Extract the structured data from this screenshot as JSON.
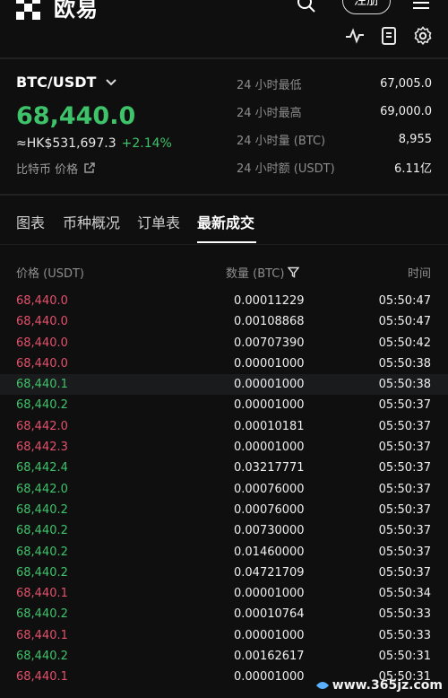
{
  "header": {
    "logo_text": "欧易",
    "register_label": "注册"
  },
  "ticker": {
    "pair": "BTC/USDT",
    "price": "68,440.0",
    "fiat_price": "≈HK$531,697.3",
    "change": "+2.14%",
    "link_label": "比特币 价格",
    "stats": [
      {
        "label": "24 小时最低",
        "value": "67,005.0"
      },
      {
        "label": "24 小时最高",
        "value": "69,000.0"
      },
      {
        "label": "24 小时量 (BTC)",
        "value": "8,955"
      },
      {
        "label": "24 小时额 (USDT)",
        "value": "6.11亿"
      }
    ]
  },
  "tabs": [
    {
      "label": "图表"
    },
    {
      "label": "币种概况"
    },
    {
      "label": "订单表"
    },
    {
      "label": "最新成交"
    }
  ],
  "columns": {
    "price": "价格 (USDT)",
    "qty": "数量 (BTC)",
    "time": "时间"
  },
  "trades": [
    {
      "price": "68,440.0",
      "qty": "0.00011229",
      "time": "05:50:47",
      "side": "sell"
    },
    {
      "price": "68,440.0",
      "qty": "0.00108868",
      "time": "05:50:47",
      "side": "sell"
    },
    {
      "price": "68,440.0",
      "qty": "0.00707390",
      "time": "05:50:42",
      "side": "sell"
    },
    {
      "price": "68,440.0",
      "qty": "0.00001000",
      "time": "05:50:38",
      "side": "sell"
    },
    {
      "price": "68,440.1",
      "qty": "0.00001000",
      "time": "05:50:38",
      "side": "buy"
    },
    {
      "price": "68,440.2",
      "qty": "0.00001000",
      "time": "05:50:37",
      "side": "buy"
    },
    {
      "price": "68,442.0",
      "qty": "0.00010181",
      "time": "05:50:37",
      "side": "sell"
    },
    {
      "price": "68,442.3",
      "qty": "0.00001000",
      "time": "05:50:37",
      "side": "sell"
    },
    {
      "price": "68,442.4",
      "qty": "0.03217771",
      "time": "05:50:37",
      "side": "buy"
    },
    {
      "price": "68,442.0",
      "qty": "0.00076000",
      "time": "05:50:37",
      "side": "buy"
    },
    {
      "price": "68,440.2",
      "qty": "0.00076000",
      "time": "05:50:37",
      "side": "buy"
    },
    {
      "price": "68,440.2",
      "qty": "0.00730000",
      "time": "05:50:37",
      "side": "buy"
    },
    {
      "price": "68,440.2",
      "qty": "0.01460000",
      "time": "05:50:37",
      "side": "buy"
    },
    {
      "price": "68,440.2",
      "qty": "0.04721709",
      "time": "05:50:37",
      "side": "buy"
    },
    {
      "price": "68,440.1",
      "qty": "0.00001000",
      "time": "05:50:34",
      "side": "sell"
    },
    {
      "price": "68,440.2",
      "qty": "0.00010764",
      "time": "05:50:33",
      "side": "buy"
    },
    {
      "price": "68,440.1",
      "qty": "0.00001000",
      "time": "05:50:33",
      "side": "sell"
    },
    {
      "price": "68,440.2",
      "qty": "0.00162617",
      "time": "05:50:31",
      "side": "buy"
    },
    {
      "price": "68,440.1",
      "qty": "0.00001000",
      "time": "05:50:31",
      "side": "sell"
    }
  ],
  "watermark": "www.365jz.com",
  "colors": {
    "buy": "#3ec36a",
    "sell": "#e5506a",
    "background": "#0f0f10"
  }
}
